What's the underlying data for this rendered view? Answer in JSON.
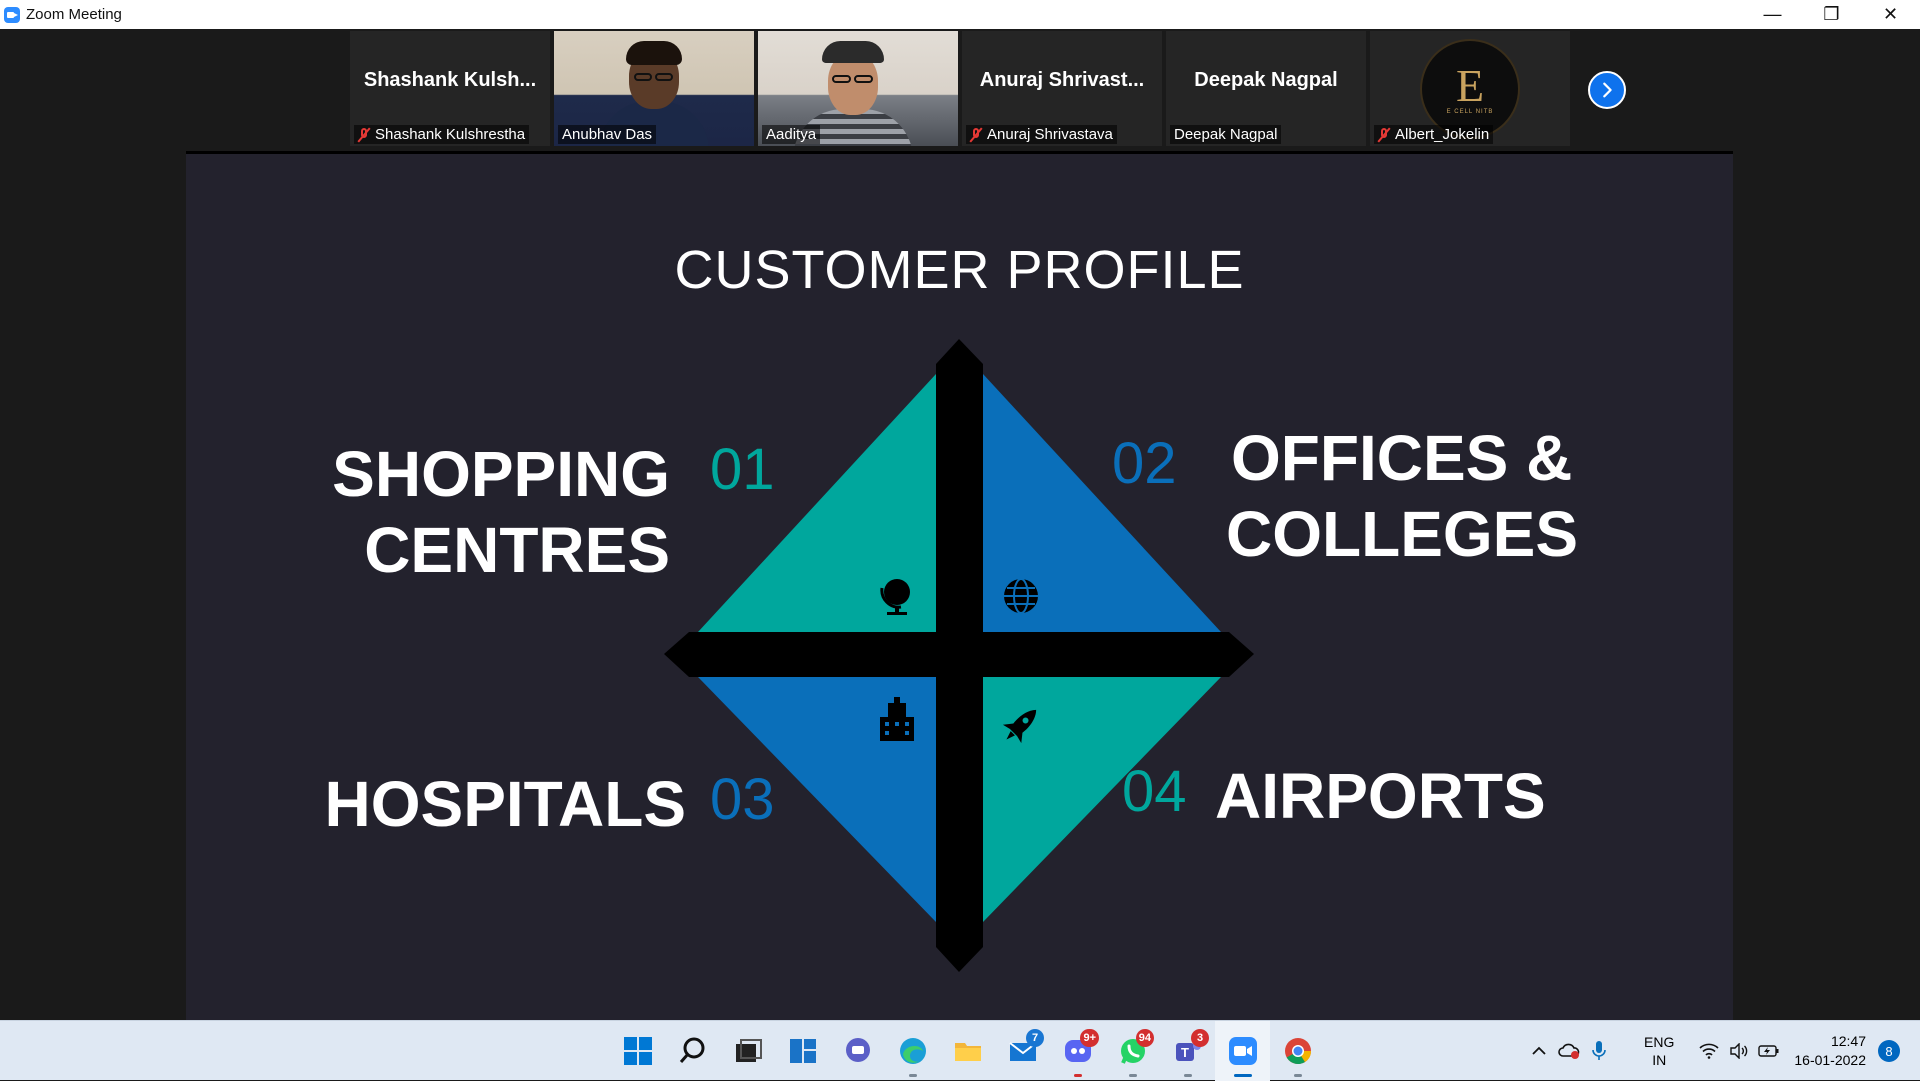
{
  "window": {
    "title": "Zoom Meeting",
    "minimize_glyph": "—",
    "restore_glyph": "❐",
    "close_glyph": "✕"
  },
  "participants": [
    {
      "big_name": "Shashank  Kulsh...",
      "label": "Shashank Kulshrestha",
      "muted": true,
      "video": false
    },
    {
      "big_name": "",
      "label": "Anubhav Das",
      "muted": false,
      "video": true,
      "active_speaker": true
    },
    {
      "big_name": "",
      "label": "Aaditya",
      "muted": false,
      "video": true
    },
    {
      "big_name": "Anuraj  Shrivast...",
      "label": "Anuraj Shrivastava",
      "muted": true,
      "video": false
    },
    {
      "big_name": "Deepak Nagpal",
      "label": "Deepak Nagpal",
      "muted": false,
      "video": false
    },
    {
      "big_name": "",
      "label": "Albert_Jokelin",
      "muted": true,
      "video": false,
      "logo_letter": "E",
      "logo_sub": "E CELL NITB"
    }
  ],
  "slide": {
    "title": "CUSTOMER PROFILE",
    "quadrants": [
      {
        "number": "01",
        "label_line1": "SHOPPING",
        "label_line2": "CENTRES",
        "icon": "globe-stand-icon"
      },
      {
        "number": "02",
        "label_line1": "OFFICES &",
        "label_line2": "COLLEGES",
        "icon": "globe-icon"
      },
      {
        "number": "03",
        "label_line1": "HOSPITALS",
        "label_line2": "",
        "icon": "building-icon"
      },
      {
        "number": "04",
        "label_line1": "AIRPORTS",
        "label_line2": "",
        "icon": "rocket-icon"
      }
    ],
    "colors": {
      "teal": "#00a79d",
      "blue": "#0a6fba",
      "bg": "#23222d",
      "cross": "#000000"
    }
  },
  "taskbar": {
    "apps": [
      {
        "name": "start",
        "badge": ""
      },
      {
        "name": "search",
        "badge": ""
      },
      {
        "name": "task-view",
        "badge": ""
      },
      {
        "name": "widgets",
        "badge": ""
      },
      {
        "name": "chat",
        "badge": ""
      },
      {
        "name": "edge",
        "badge": ""
      },
      {
        "name": "file-explorer",
        "badge": ""
      },
      {
        "name": "mail",
        "badge": "7"
      },
      {
        "name": "discord",
        "badge": "9+"
      },
      {
        "name": "whatsapp",
        "badge": "94"
      },
      {
        "name": "teams",
        "badge": "3"
      },
      {
        "name": "zoom",
        "badge": ""
      },
      {
        "name": "chrome",
        "badge": ""
      }
    ],
    "tray": {
      "lang_line1": "ENG",
      "lang_line2": "IN",
      "time": "12:47",
      "date": "16-01-2022",
      "notifications": "8"
    }
  }
}
